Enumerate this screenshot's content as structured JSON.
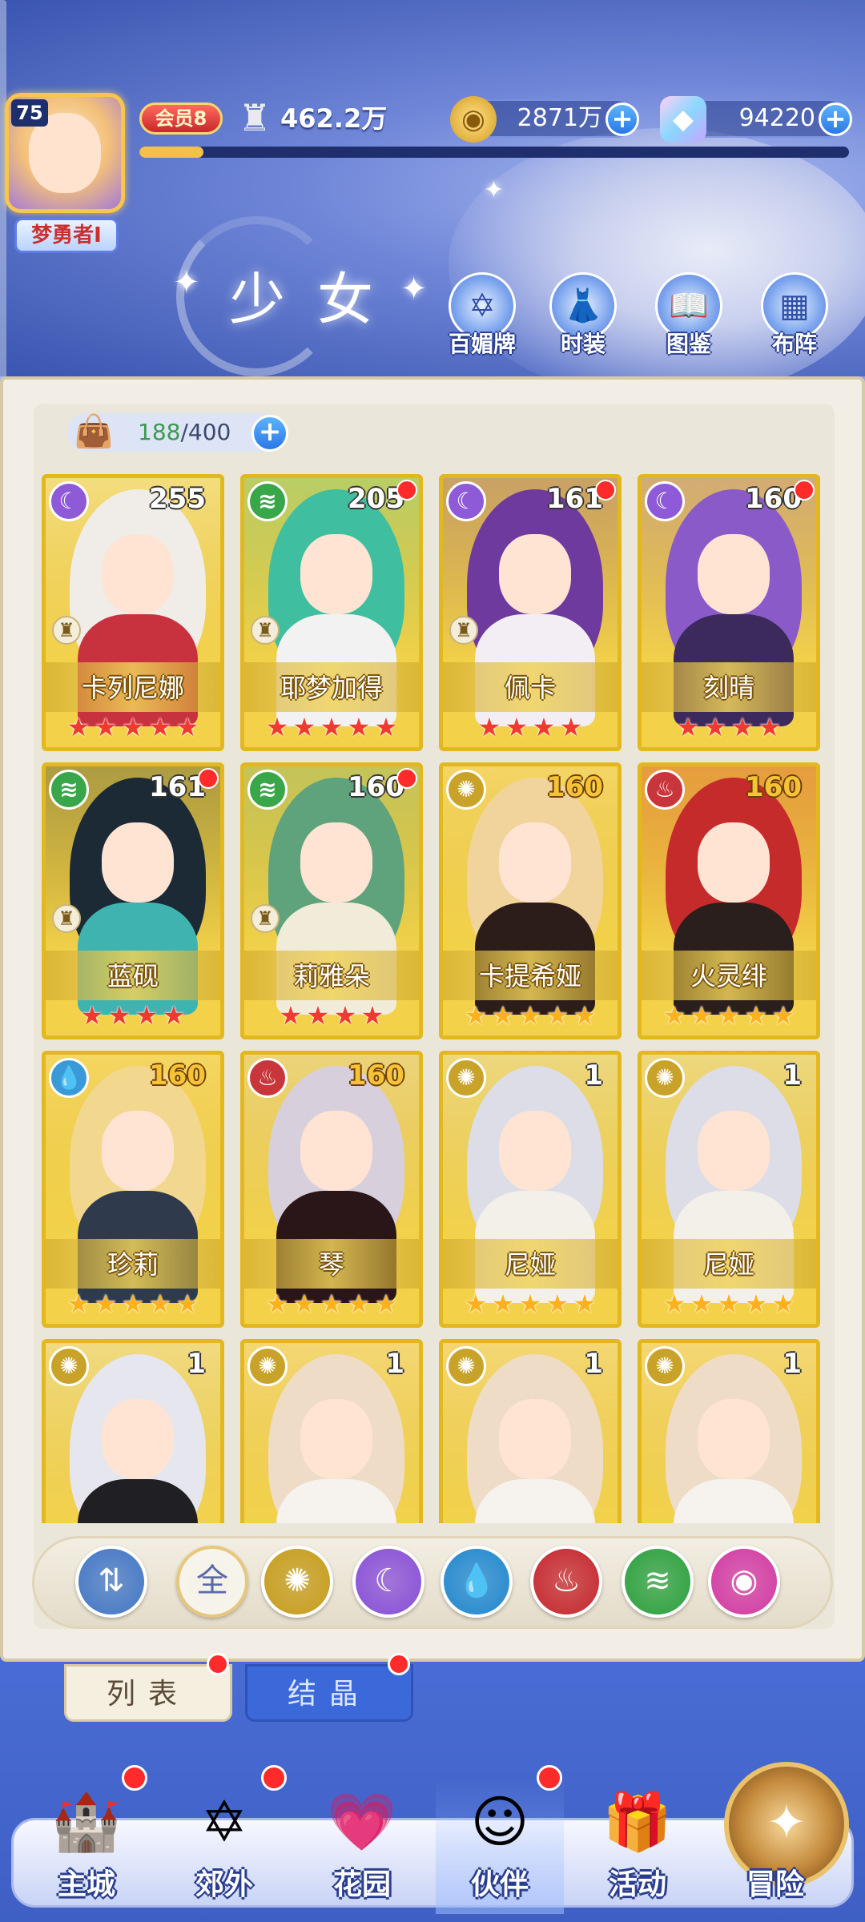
{
  "header": {
    "player_level": "75",
    "player_name": "梦勇者Ⅰ",
    "vip_label": "会员8",
    "power_value": "462.2万",
    "exp_progress": 0.09,
    "gold": "2871万",
    "gems": "94220",
    "title": "少女"
  },
  "top_buttons": [
    {
      "label": "百媚牌",
      "icon": "card-deck-icon",
      "glyph": "✡"
    },
    {
      "label": "时装",
      "icon": "costume-icon",
      "glyph": "👗"
    },
    {
      "label": "图鉴",
      "icon": "book-icon",
      "glyph": "📖"
    },
    {
      "label": "布阵",
      "icon": "formation-grid-icon",
      "glyph": "▦"
    }
  ],
  "collection": {
    "current": "188",
    "max": "/400"
  },
  "cards": [
    {
      "name": "卡列尼娜",
      "level": "255",
      "element": "moon",
      "stars": 5,
      "star_color": "red",
      "dot": false,
      "chess": true,
      "level_gold": false,
      "palette": [
        "#f0ede8",
        "#c8323e"
      ]
    },
    {
      "name": "耶梦加得",
      "level": "205",
      "element": "wind",
      "stars": 5,
      "star_color": "red",
      "dot": true,
      "chess": true,
      "level_gold": false,
      "palette": [
        "#3fbf9f",
        "#f2f2f2"
      ]
    },
    {
      "name": "佩卡",
      "level": "161",
      "element": "moon",
      "stars": 4,
      "star_color": "red",
      "dot": true,
      "chess": true,
      "level_gold": false,
      "palette": [
        "#6e3a9e",
        "#f2eef4"
      ]
    },
    {
      "name": "刻晴",
      "level": "160",
      "element": "moon",
      "stars": 4,
      "star_color": "red",
      "dot": true,
      "chess": false,
      "level_gold": false,
      "palette": [
        "#8a5ac9",
        "#3c2a5c"
      ]
    },
    {
      "name": "蓝砚",
      "level": "161",
      "element": "wind",
      "stars": 4,
      "star_color": "red",
      "dot": true,
      "chess": true,
      "level_gold": false,
      "palette": [
        "#1c2a36",
        "#3fb3b0"
      ]
    },
    {
      "name": "莉雅朵",
      "level": "160",
      "element": "wind",
      "stars": 4,
      "star_color": "red",
      "dot": true,
      "chess": true,
      "level_gold": false,
      "palette": [
        "#5fa37c",
        "#f1ecd9"
      ]
    },
    {
      "name": "卡提希娅",
      "level": "160",
      "element": "sun",
      "stars": 5,
      "star_color": "gold",
      "dot": false,
      "chess": false,
      "level_gold": true,
      "palette": [
        "#f0d49b",
        "#2c1c1a"
      ]
    },
    {
      "name": "火灵绯",
      "level": "160",
      "element": "fire",
      "stars": 5,
      "star_color": "gold",
      "dot": false,
      "chess": false,
      "level_gold": true,
      "palette": [
        "#c52b2b",
        "#2a1f1c"
      ]
    },
    {
      "name": "珍莉",
      "level": "160",
      "element": "water",
      "stars": 5,
      "star_color": "gold",
      "dot": false,
      "chess": false,
      "level_gold": true,
      "palette": [
        "#f2d88f",
        "#2f3a4c"
      ]
    },
    {
      "name": "琴",
      "level": "160",
      "element": "fire",
      "stars": 5,
      "star_color": "gold",
      "dot": false,
      "chess": false,
      "level_gold": true,
      "palette": [
        "#d7d0dc",
        "#2a1618"
      ]
    },
    {
      "name": "尼娅",
      "level": "1",
      "element": "sun",
      "stars": 5,
      "star_color": "gold",
      "dot": false,
      "chess": false,
      "level_gold": false,
      "palette": [
        "#dcdde6",
        "#f3efe9"
      ]
    },
    {
      "name": "尼娅",
      "level": "1",
      "element": "sun",
      "stars": 5,
      "star_color": "gold",
      "dot": false,
      "chess": false,
      "level_gold": false,
      "palette": [
        "#dcdde6",
        "#f3efe9"
      ]
    },
    {
      "name": "",
      "level": "1",
      "element": "sun",
      "stars": 0,
      "star_color": "gold",
      "dot": false,
      "chess": false,
      "level_gold": false,
      "palette": [
        "#e6e6ee",
        "#1f1f24"
      ]
    },
    {
      "name": "",
      "level": "1",
      "element": "sun",
      "stars": 0,
      "star_color": "gold",
      "dot": false,
      "chess": false,
      "level_gold": false,
      "palette": [
        "#efdcc6",
        "#f6f2ee"
      ]
    },
    {
      "name": "",
      "level": "1",
      "element": "sun",
      "stars": 0,
      "star_color": "gold",
      "dot": false,
      "chess": false,
      "level_gold": false,
      "palette": [
        "#efdcc6",
        "#f6f2ee"
      ]
    },
    {
      "name": "",
      "level": "1",
      "element": "sun",
      "stars": 0,
      "star_color": "gold",
      "dot": false,
      "chess": false,
      "level_gold": false,
      "palette": [
        "#efdcc6",
        "#f6f2ee"
      ]
    }
  ],
  "element_styles": {
    "moon": {
      "color": "#8f5ad8",
      "glyph": "☾"
    },
    "wind": {
      "color": "#3aa64a",
      "glyph": "≋"
    },
    "sun": {
      "color": "#c9a22a",
      "glyph": "✺"
    },
    "fire": {
      "color": "#c8353a",
      "glyph": "♨"
    },
    "water": {
      "color": "#3a9ad8",
      "glyph": "💧"
    }
  },
  "filters": [
    {
      "name": "sort-filter",
      "label": "⇅",
      "color": "#4f7fc8",
      "icon": "sort-icon"
    },
    {
      "name": "all-filter",
      "label": "全",
      "color": "#f7f4ec",
      "icon": "all-icon"
    },
    {
      "name": "sun-filter",
      "label": "✺",
      "color": "#c9a22a",
      "icon": "sun-element-icon"
    },
    {
      "name": "moon-filter",
      "label": "☾",
      "color": "#8f5ad8",
      "icon": "moon-element-icon"
    },
    {
      "name": "water-filter",
      "label": "💧",
      "color": "#2f8fd1",
      "icon": "water-element-icon"
    },
    {
      "name": "fire-filter",
      "label": "♨",
      "color": "#c8353a",
      "icon": "fire-element-icon"
    },
    {
      "name": "wind-filter",
      "label": "≋",
      "color": "#3aa64a",
      "icon": "wind-element-icon"
    },
    {
      "name": "star-filter",
      "label": "◉",
      "color": "#d447a8",
      "icon": "star-element-icon"
    }
  ],
  "tabs": {
    "list": "列表",
    "crystal": "结晶"
  },
  "bottom_nav": [
    {
      "label": "主城",
      "icon": "castle-icon",
      "glyph": "🏰",
      "dot": true
    },
    {
      "label": "郊外",
      "icon": "portal-icon",
      "glyph": "✡",
      "dot": true
    },
    {
      "label": "花园",
      "icon": "heart-garden-icon",
      "glyph": "💗",
      "dot": false
    },
    {
      "label": "伙伴",
      "icon": "partner-icon",
      "glyph": "☺",
      "dot": true
    },
    {
      "label": "活动",
      "icon": "gift-icon",
      "glyph": "🎁",
      "dot": false
    },
    {
      "label": "冒险",
      "icon": "compass-icon",
      "glyph": "✦",
      "dot": false
    }
  ]
}
